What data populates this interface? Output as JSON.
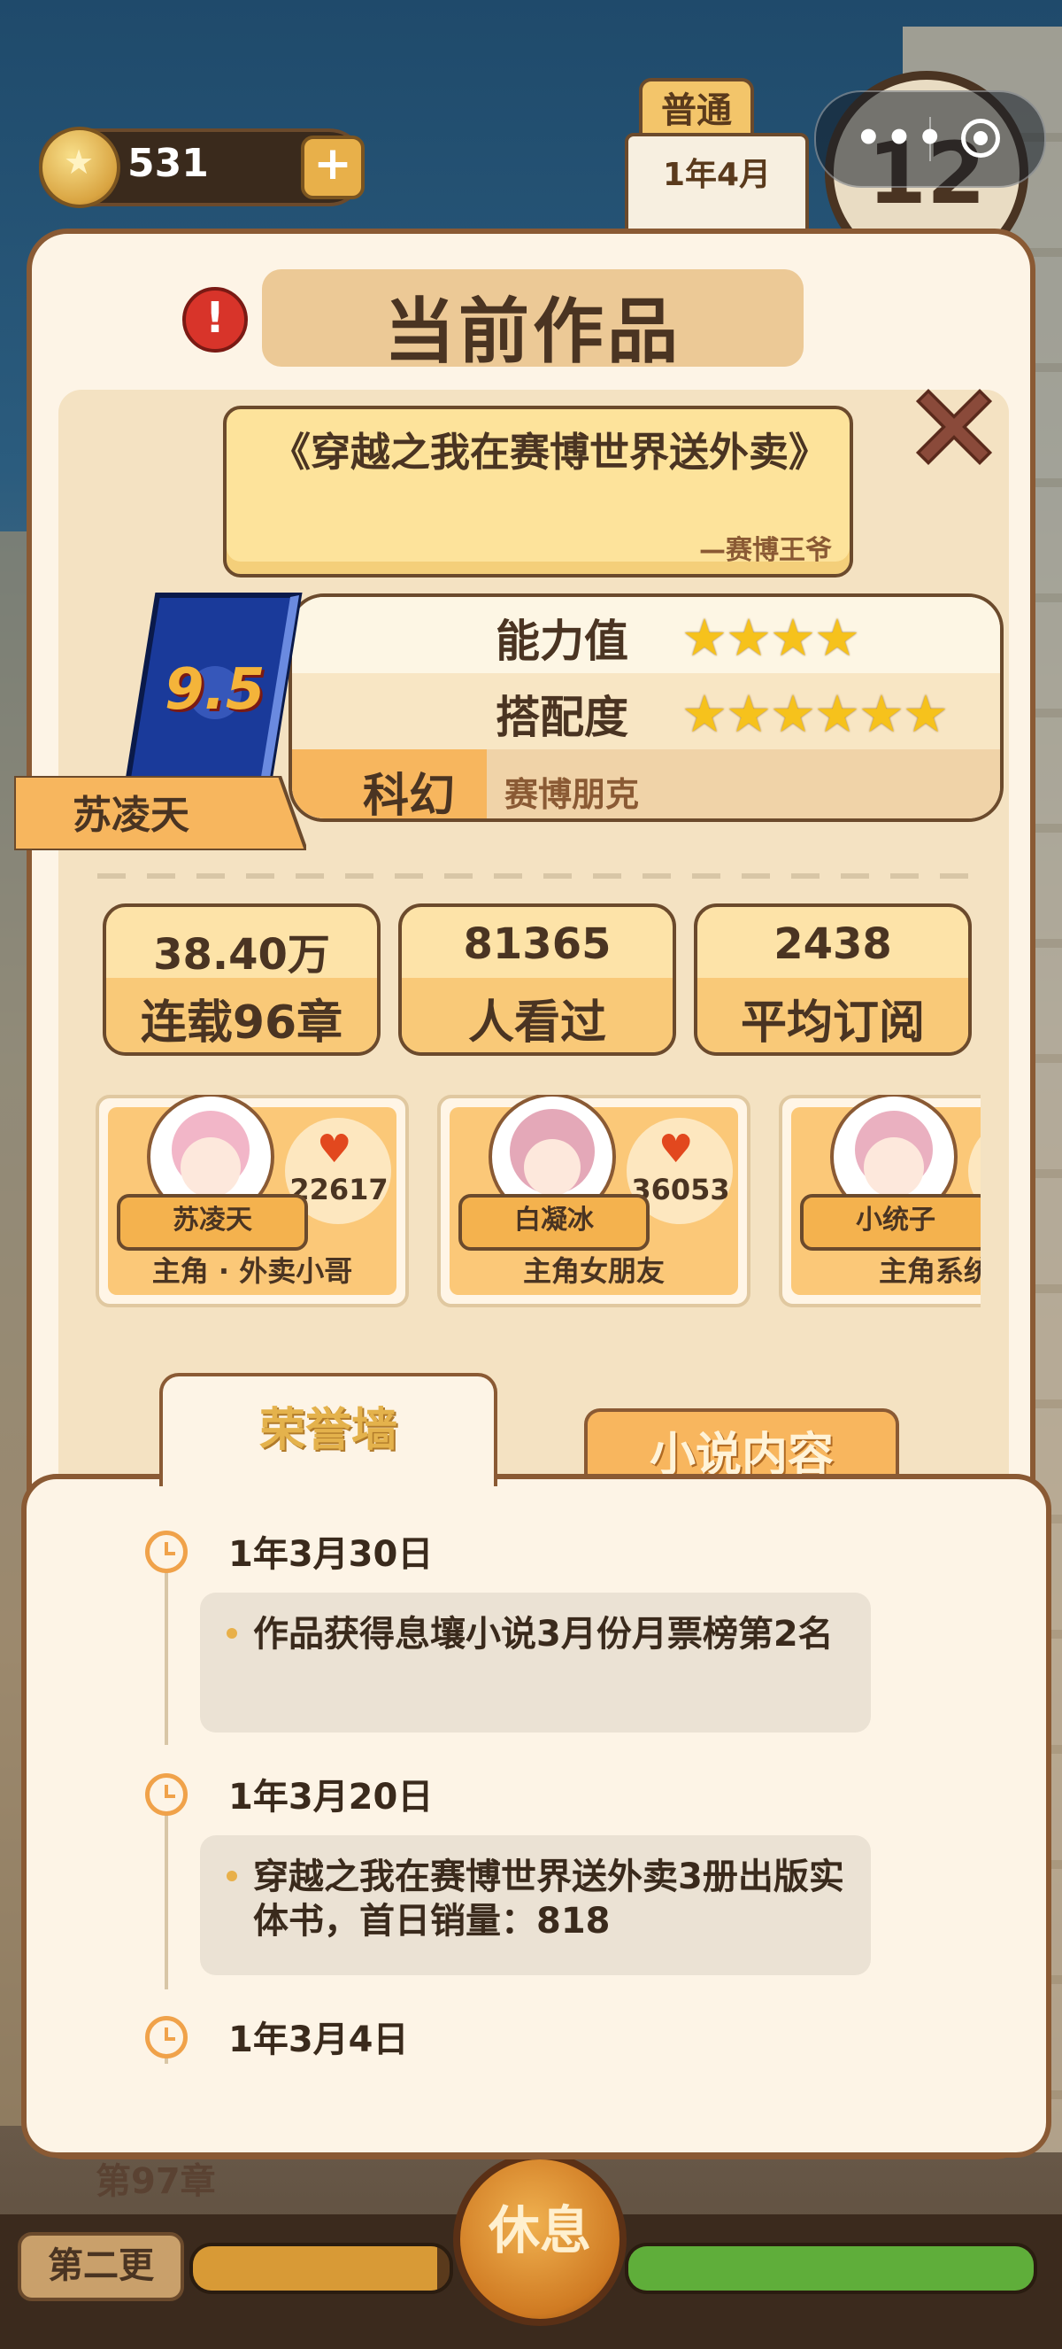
{
  "hud": {
    "coins": "531",
    "mode": "普通",
    "date": "1年4月",
    "clock_hour": "12",
    "bottom_row_text": "第97章",
    "second_shift_label": "第二更",
    "rest_label": "休息",
    "progress_left": 0.95,
    "progress_right": 1.0
  },
  "modal": {
    "title": "当前作品",
    "book_title": "《穿越之我在赛博世界送外卖》",
    "book_author": "—赛博王爷",
    "rating": "9.5",
    "author_name": "苏凌天",
    "ability_label": "能力值",
    "ability_stars": 4,
    "match_label": "搭配度",
    "match_stars": 6,
    "genre": "科幻",
    "subgenre": "赛博朋克",
    "stats": [
      {
        "value": "38.40万",
        "label": "连载96章"
      },
      {
        "value": "81365",
        "label": "人看过"
      },
      {
        "value": "2438",
        "label": "平均订阅"
      }
    ],
    "characters": [
      {
        "name": "苏凌天",
        "likes": "22617",
        "role": "主角 · 外卖小哥"
      },
      {
        "name": "白凝冰",
        "likes": "36053",
        "role": "主角女朋友"
      },
      {
        "name": "小统子",
        "likes": "",
        "role": "主角系统"
      }
    ],
    "tabs": {
      "honor": "荣誉墙",
      "content": "小说内容"
    },
    "events": [
      {
        "date": "1年3月30日",
        "text": "作品获得息壤小说3月份月票榜第2名"
      },
      {
        "date": "1年3月20日",
        "text": "穿越之我在赛博世界送外卖3册出版实体书，首日销量：818"
      },
      {
        "date": "1年3月4日",
        "text": ""
      }
    ]
  },
  "colors": {
    "accent": "#f4b24e",
    "border": "#6b4a2c",
    "star": "#f6c21c",
    "heart": "#e2481e"
  }
}
